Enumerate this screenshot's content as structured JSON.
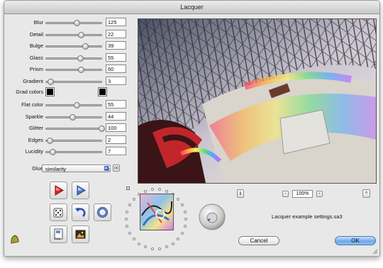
{
  "window": {
    "title": "Lacquer"
  },
  "sliders": [
    {
      "label": "Blur",
      "value": "125",
      "level": 0.55
    },
    {
      "label": "Detail",
      "value": "22",
      "level": 0.63
    },
    {
      "label": "Bulge",
      "value": "39",
      "level": 0.7
    },
    {
      "label": "Glass",
      "value": "55",
      "level": 0.62
    },
    {
      "label": "Prism",
      "value": "60",
      "level": 0.63
    },
    {
      "label": "Gradient",
      "value": "3",
      "level": 0.08
    }
  ],
  "grad_colors": {
    "label": "Grad colors",
    "left": "#000000",
    "right": "#000000"
  },
  "sliders2": [
    {
      "label": "Flat color",
      "value": "55",
      "level": 0.55
    },
    {
      "label": "Sparkle",
      "value": "44",
      "level": 0.48
    },
    {
      "label": "Glitter",
      "value": "100",
      "level": 1.0
    },
    {
      "label": "Edges",
      "value": "2",
      "level": 0.07
    },
    {
      "label": "Lucidity",
      "value": "7",
      "level": 0.12
    }
  ],
  "glue": {
    "label": "Glue",
    "value": "similarity",
    "side_button": "(a)"
  },
  "zoom": {
    "value": "100%",
    "minus": "-",
    "plus": "+"
  },
  "info_button": "i",
  "up_button": "^",
  "settings_file": "Lacquer example settings.sa3",
  "buttons": {
    "cancel": "Cancel",
    "ok": "OK"
  },
  "file_icon_label": "FILE"
}
